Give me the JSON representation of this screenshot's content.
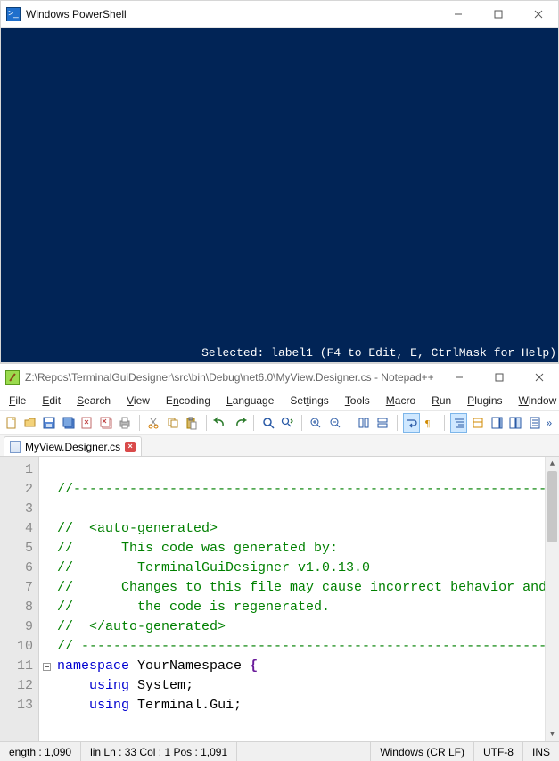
{
  "powershell": {
    "title": "Windows PowerShell",
    "status_line": "Selected: label1 (F4 to Edit, E, CtrlMask for Help)",
    "background": "#012456"
  },
  "notepadpp": {
    "title": "Z:\\Repos\\TerminalGuiDesigner\\src\\bin\\Debug\\net6.0\\MyView.Designer.cs - Notepad++",
    "menu": {
      "file": {
        "label": "File",
        "accel_index": 0
      },
      "edit": {
        "label": "Edit",
        "accel_index": 0
      },
      "search": {
        "label": "Search",
        "accel_index": 0
      },
      "view": {
        "label": "View",
        "accel_index": 0
      },
      "encoding": {
        "label": "Encoding",
        "accel_index": 1
      },
      "language": {
        "label": "Language",
        "accel_index": 0
      },
      "settings": {
        "label": "Settings",
        "accel_index": 3
      },
      "tools": {
        "label": "Tools",
        "accel_index": 0
      },
      "macro": {
        "label": "Macro",
        "accel_index": 0
      },
      "run": {
        "label": "Run",
        "accel_index": 0
      },
      "plugins": {
        "label": "Plugins",
        "accel_index": 0
      },
      "window": {
        "label": "Window",
        "accel_index": 0
      },
      "help": {
        "label": "?"
      },
      "close_x": {
        "label": "X"
      }
    },
    "tab": {
      "label": "MyView.Designer.cs"
    },
    "code": {
      "lines": [
        {
          "n": "1",
          "html": ""
        },
        {
          "n": "2",
          "html": "<span class='c-green'>//----------------------------------------------------------------------</span>"
        },
        {
          "n": "3",
          "html": ""
        },
        {
          "n": "4",
          "html": "<span class='c-green'>//  &lt;auto-generated&gt;</span>"
        },
        {
          "n": "5",
          "html": "<span class='c-green'>//      This code was generated by:</span>"
        },
        {
          "n": "6",
          "html": "<span class='c-green'>//        TerminalGuiDesigner v1.0.13.0</span>"
        },
        {
          "n": "7",
          "html": "<span class='c-green'>//      Changes to this file may cause incorrect behavior and will be lost if</span>"
        },
        {
          "n": "8",
          "html": "<span class='c-green'>//        the code is regenerated.</span>"
        },
        {
          "n": "9",
          "html": "<span class='c-green'>//  &lt;/auto-generated&gt;</span>"
        },
        {
          "n": "10",
          "html": "<span class='c-green'>// ----------------------------------------------------------------------</span>"
        },
        {
          "n": "11",
          "html": "<span class='c-blue'>namespace</span> <span class='default'>YourNamespace</span> <span class='brace'>{</span>",
          "fold": true
        },
        {
          "n": "12",
          "html": "    <span class='c-blue'>using</span> <span class='default'>System</span><span class='default'>;</span>"
        },
        {
          "n": "13",
          "html": "    <span class='c-blue'>using</span> <span class='default'>Terminal</span><span class='default'>.</span><span class='default'>Gui</span><span class='default'>;</span>"
        }
      ]
    },
    "status": {
      "length": "ength : 1,090",
      "caret": "lin Ln : 33    Col : 1    Pos : 1,091",
      "eol": "Windows (CR LF)",
      "enc": "UTF-8",
      "ins": "INS"
    }
  }
}
